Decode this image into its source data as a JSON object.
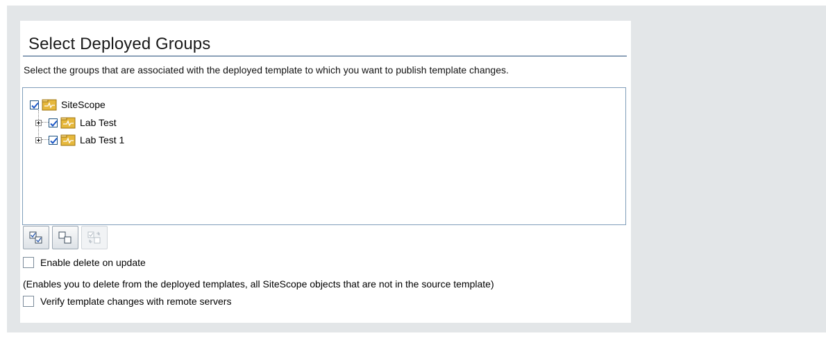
{
  "page": {
    "title": "Select Deployed Groups",
    "description": "Select the groups that are associated with the deployed template to which you want to publish template changes."
  },
  "tree": {
    "root": {
      "label": "SiteScope",
      "checked": true,
      "icon": "group-folder-icon"
    },
    "children": [
      {
        "label": "Lab Test",
        "checked": true,
        "expandable": true,
        "icon": "group-folder-icon"
      },
      {
        "label": "Lab Test 1",
        "checked": true,
        "expandable": true,
        "icon": "group-folder-icon"
      }
    ]
  },
  "toolbar": {
    "buttons": [
      {
        "name": "select-all-icon",
        "enabled": true
      },
      {
        "name": "clear-selection-icon",
        "enabled": true
      },
      {
        "name": "invert-selection-icon",
        "enabled": false
      }
    ]
  },
  "options": {
    "enable_delete": {
      "label": "Enable delete on update",
      "checked": false
    },
    "enable_delete_note": "(Enables you to delete from the deployed templates, all SiteScope objects that are not in the source template)",
    "verify_changes": {
      "label": "Verify template changes with remote servers",
      "checked": false
    }
  },
  "colors": {
    "background": "#e3e6e8",
    "accent_line": "#8aa0b8",
    "folder": "#d9a72a"
  }
}
